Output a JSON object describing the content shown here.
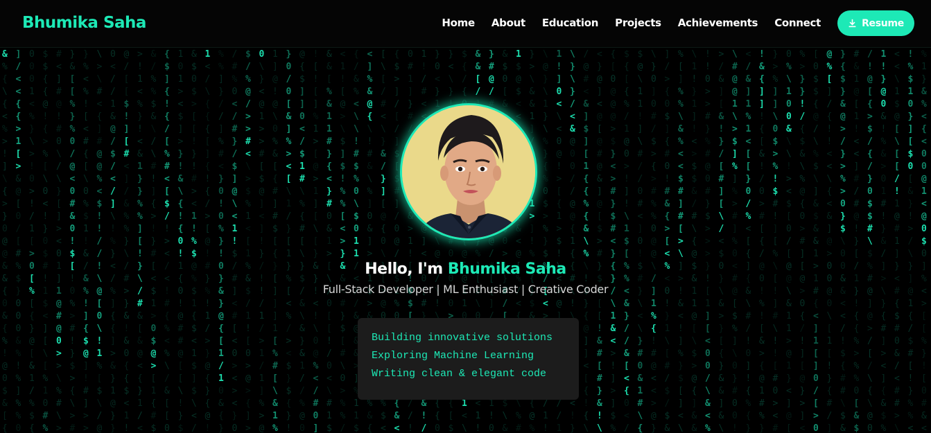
{
  "header": {
    "brand": "Bhumika Saha",
    "nav": [
      "Home",
      "About",
      "Education",
      "Projects",
      "Achievements",
      "Connect"
    ],
    "resume_label": "Resume",
    "resume_icon": "download-icon"
  },
  "hero": {
    "greeting": "Hello, I'm ",
    "name": "Bhumika Saha",
    "subtitle": "Full-Stack Developer | ML Enthusiast | Creative Coder",
    "lines": [
      "Building innovative solutions",
      "Exploring Machine Learning",
      "Writing clean & elegant code"
    ]
  },
  "background": {
    "effect": "matrix-rain",
    "glyphs": "!#$%&@[]{}<>\\/01",
    "color": "#1de9b6"
  },
  "colors": {
    "accent": "#1de9b6",
    "nav_bg": "#050505",
    "page_bg": "#000000",
    "box_bg": "#1c1c1c"
  }
}
